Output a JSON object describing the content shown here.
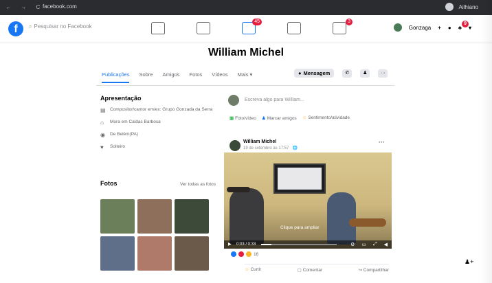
{
  "browser": {
    "url": "facebook.com",
    "profile_label": "Ailhiano",
    "nav_glyphs": "← → C"
  },
  "topbar": {
    "logo": "f",
    "search_placeholder": "Pesquisar no Facebook",
    "watch_badge": "45",
    "groups_badge": "3",
    "user_name": "Gonzaga",
    "notifications_badge": "9"
  },
  "profile": {
    "name": "William Michel",
    "tabs": [
      "Publicações",
      "Sobre",
      "Amigos",
      "Fotos",
      "Vídeos",
      "Mais ▾"
    ],
    "message_button": "Mensagem"
  },
  "intro": {
    "title": "Apresentação",
    "items": [
      {
        "icon": "briefcase-icon",
        "glyph": "▤",
        "text": "Compositor/cantor em/ex: Grupo Gonzada da Serra"
      },
      {
        "icon": "home-icon",
        "glyph": "⌂",
        "text": "Mora em Caldas Barbosa"
      },
      {
        "icon": "location-icon",
        "glyph": "◉",
        "text": "De Belém(PA)"
      },
      {
        "icon": "heart-icon",
        "glyph": "♥",
        "text": "Solteiro"
      }
    ]
  },
  "photos": {
    "title": "Fotos",
    "see_all": "Ver todas as fotos",
    "colors": [
      "#6a7f5a",
      "#8d6f5b",
      "#3d4a3a",
      "#5f6f8a",
      "#b07a6a",
      "#6b5a4a"
    ]
  },
  "composer": {
    "placeholder": "Escreva algo para William...",
    "actions": [
      "Foto/vídeo",
      "Marcar amigos",
      "Sentimento/atividade"
    ]
  },
  "post": {
    "author": "William Michel",
    "meta": "19 de setembro às 17:57 · 🌐",
    "video_title": "Clique para ampliar",
    "time": "0:03 / 0:33",
    "progress": 0.14,
    "reactions_count": "16",
    "actions": [
      "Curtir",
      "Comentar",
      "Compartilhar"
    ]
  },
  "colors": {
    "brand": "#1877f2",
    "badge": "#e41e3f"
  }
}
